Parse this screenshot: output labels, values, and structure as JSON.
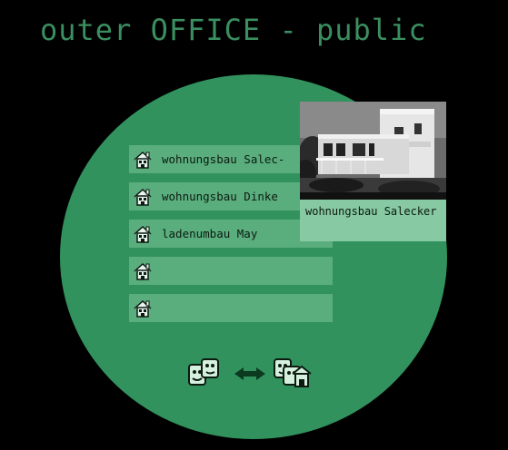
{
  "header": {
    "title": "outer OFFICE - public"
  },
  "items": [
    {
      "label": "wohnungsbau Salec-",
      "icon": "house-icon"
    },
    {
      "label": "wohnungsbau Dinke",
      "icon": "house-icon"
    },
    {
      "label": "ladenumbau May",
      "icon": "house-icon"
    },
    {
      "label": "",
      "icon": "house-icon"
    },
    {
      "label": "",
      "icon": "house-icon"
    }
  ],
  "preview": {
    "caption": "wohnungsbau Salecker"
  },
  "footer": {
    "left_icon": "people-icon",
    "middle_icon": "swap-arrows-icon",
    "right_icon": "people-house-icon"
  },
  "colors": {
    "background": "#000000",
    "title": "#3a8e60",
    "disk": "#32925e",
    "item": "#5aae7e",
    "preview": "#86c9a2"
  }
}
